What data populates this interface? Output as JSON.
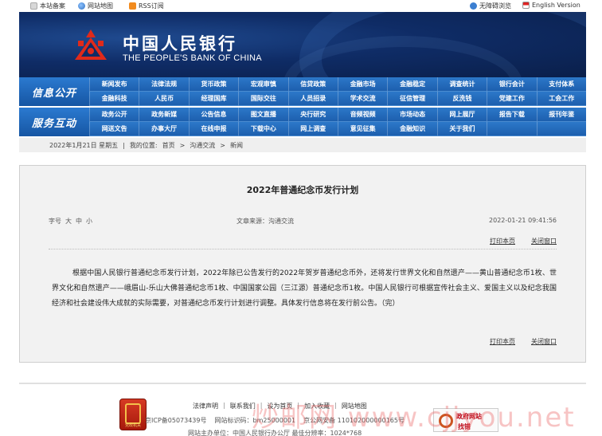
{
  "topbar": {
    "left": [
      {
        "icon": "star-icon",
        "label": "本站备案"
      },
      {
        "icon": "globe-icon",
        "label": "网站地图"
      },
      {
        "icon": "rss-icon",
        "label": "RSS订阅"
      }
    ],
    "right": [
      {
        "icon": "accessibility-icon",
        "label": "无障碍浏览"
      },
      {
        "icon": "flag-icon",
        "label": "English Version"
      }
    ]
  },
  "header": {
    "cn_name": "中国人民银行",
    "en_name": "THE PEOPLE'S BANK OF CHINA"
  },
  "nav": [
    {
      "label": "信息公开",
      "items": [
        "新闻发布",
        "法律法规",
        "货币政策",
        "宏观审慎",
        "信贷政策",
        "金融市场",
        "金融稳定",
        "调查统计",
        "银行会计",
        "支付体系",
        "金融科技",
        "人民币",
        "经理国库",
        "国际交往",
        "人员招录",
        "学术交流",
        "征信管理",
        "反洗钱",
        "党建工作",
        "工会工作"
      ]
    },
    {
      "label": "服务互动",
      "items": [
        "政务公开",
        "政务新媒",
        "公告信息",
        "图文直播",
        "央行研究",
        "音频视频",
        "市场动态",
        "网上展厅",
        "报告下载",
        "报刊年鉴",
        "网送文告",
        "办事大厅",
        "在线申报",
        "下载中心",
        "网上调查",
        "意见征集",
        "金融知识",
        "关于我们",
        "",
        ""
      ]
    }
  ],
  "breadcrumb": {
    "date": "2022年1月21日 星期五",
    "location_label": "我的位置:",
    "path": [
      "首页",
      "沟通交流",
      "新闻"
    ]
  },
  "article": {
    "title": "2022年普通纪念币发行计划",
    "font_label": "字号",
    "font_sizes": [
      "大",
      "中",
      "小"
    ],
    "source": "文章来源：沟通交流",
    "time": "2022-01-21 09:41:56",
    "print": "打印本页",
    "close": "关闭窗口",
    "body": "根据中国人民银行普通纪念币发行计划，2022年除已公告发行的2022年贺岁普通纪念币外，还将发行世界文化和自然遗产——黄山普通纪念币1枚、世界文化和自然遗产——峨眉山-乐山大佛普通纪念币1枚、中国国家公园（三江源）普通纪念币1枚。中国人民银行可根据宣传社会主义、爱国主义以及纪念我国经济和社会建设伟大成就的实际需要，对普通纪念币发行计划进行调整。具体发行信息将在发行前公告。（完）"
  },
  "footer": {
    "badge_caption": "党政机关",
    "links": [
      "法律声明",
      "联系我们",
      "设为首页",
      "加入收藏",
      "网站地图"
    ],
    "line2": [
      "京ICP备05073439号",
      "网站标识码：bm25000001",
      "京公网安备 110102000000165号"
    ],
    "line3": "网站主办单位：中国人民银行办公厅   最佳分辨率：1024*768",
    "gov_site_1": "政府网站",
    "gov_site_2": "找错"
  },
  "watermark": "炒邮网 www.cjjyou.net"
}
